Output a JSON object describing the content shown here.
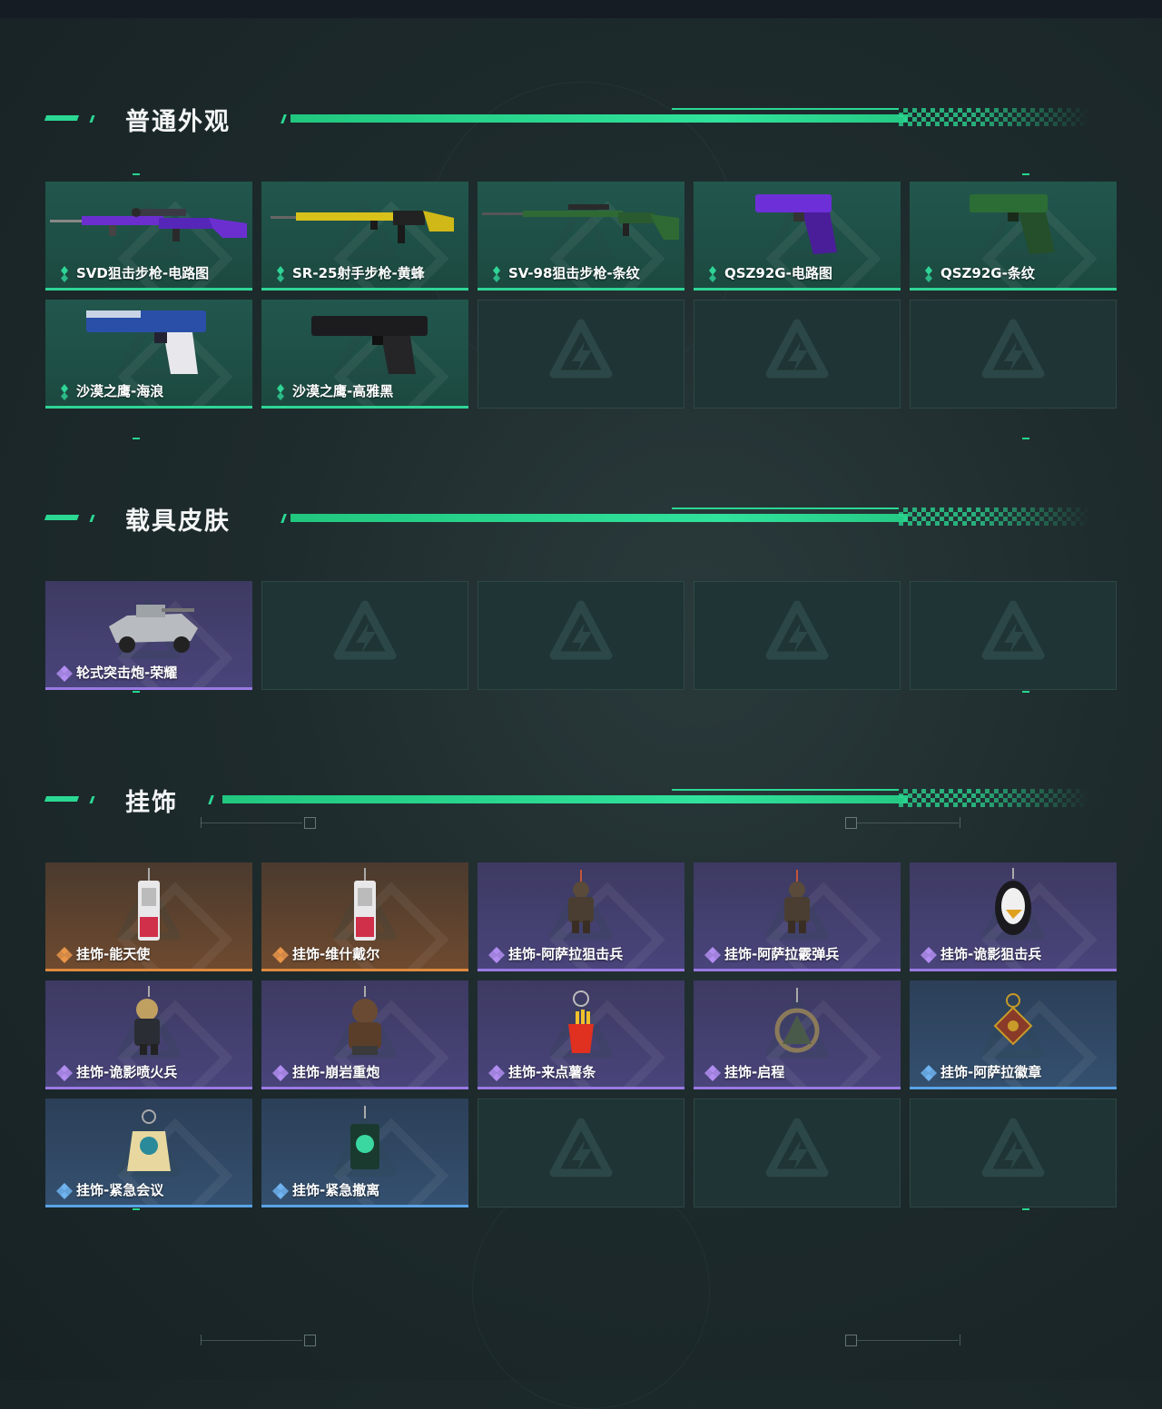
{
  "sections": [
    {
      "title": "普通外观",
      "items": [
        {
          "label": "SVD狙击步枪-电路图",
          "rarity": "green",
          "art": "sniper-rifle-purple"
        },
        {
          "label": "SR-25射手步枪-黄蜂",
          "rarity": "green",
          "art": "marksman-rifle-yellow"
        },
        {
          "label": "SV-98狙击步枪-条纹",
          "rarity": "green",
          "art": "sniper-rifle-green"
        },
        {
          "label": "QSZ92G-电路图",
          "rarity": "green",
          "art": "pistol-purple"
        },
        {
          "label": "QSZ92G-条纹",
          "rarity": "green",
          "art": "pistol-green"
        },
        {
          "label": "沙漠之鹰-海浪",
          "rarity": "green",
          "art": "deagle-blue"
        },
        {
          "label": "沙漠之鹰-高雅黑",
          "rarity": "green",
          "art": "deagle-black"
        },
        {
          "label": "",
          "rarity": "empty"
        },
        {
          "label": "",
          "rarity": "empty"
        },
        {
          "label": "",
          "rarity": "empty"
        }
      ]
    },
    {
      "title": "载具皮肤",
      "items": [
        {
          "label": "轮式突击炮-荣耀",
          "rarity": "purple",
          "art": "armored-vehicle"
        },
        {
          "label": "",
          "rarity": "empty"
        },
        {
          "label": "",
          "rarity": "empty"
        },
        {
          "label": "",
          "rarity": "empty"
        },
        {
          "label": "",
          "rarity": "empty"
        }
      ]
    },
    {
      "title": "挂饰",
      "items": [
        {
          "label": "挂饰-能天使",
          "rarity": "orange",
          "art": "charm-tag-red"
        },
        {
          "label": "挂饰-维什戴尔",
          "rarity": "orange",
          "art": "charm-tag-red"
        },
        {
          "label": "挂饰-阿萨拉狙击兵",
          "rarity": "purple",
          "art": "charm-soldier"
        },
        {
          "label": "挂饰-阿萨拉霰弹兵",
          "rarity": "purple",
          "art": "charm-soldier"
        },
        {
          "label": "挂饰-诡影狙击兵",
          "rarity": "purple",
          "art": "charm-bird"
        },
        {
          "label": "挂饰-诡影喷火兵",
          "rarity": "purple",
          "art": "charm-flamer"
        },
        {
          "label": "挂饰-崩岩重炮",
          "rarity": "purple",
          "art": "charm-heavy"
        },
        {
          "label": "挂饰-来点薯条",
          "rarity": "purple",
          "art": "charm-fries"
        },
        {
          "label": "挂饰-启程",
          "rarity": "purple",
          "art": "charm-medal"
        },
        {
          "label": "挂饰-阿萨拉徽章",
          "rarity": "blue",
          "art": "charm-badge"
        },
        {
          "label": "挂饰-紧急会议",
          "rarity": "blue",
          "art": "charm-meeting"
        },
        {
          "label": "挂饰-紧急撤离",
          "rarity": "blue",
          "art": "charm-evac"
        },
        {
          "label": "",
          "rarity": "empty"
        },
        {
          "label": "",
          "rarity": "empty"
        },
        {
          "label": "",
          "rarity": "empty"
        }
      ]
    }
  ],
  "colors": {
    "accent_green": "#2bd893",
    "rarity_green": "#2fd596",
    "rarity_purple": "#9a79e4",
    "rarity_orange": "#e08a3e",
    "rarity_blue": "#5aa3e6",
    "background": "#1e2b2d"
  },
  "icons": [
    "rarity-diamond-icon",
    "brand-watermark-icon"
  ]
}
